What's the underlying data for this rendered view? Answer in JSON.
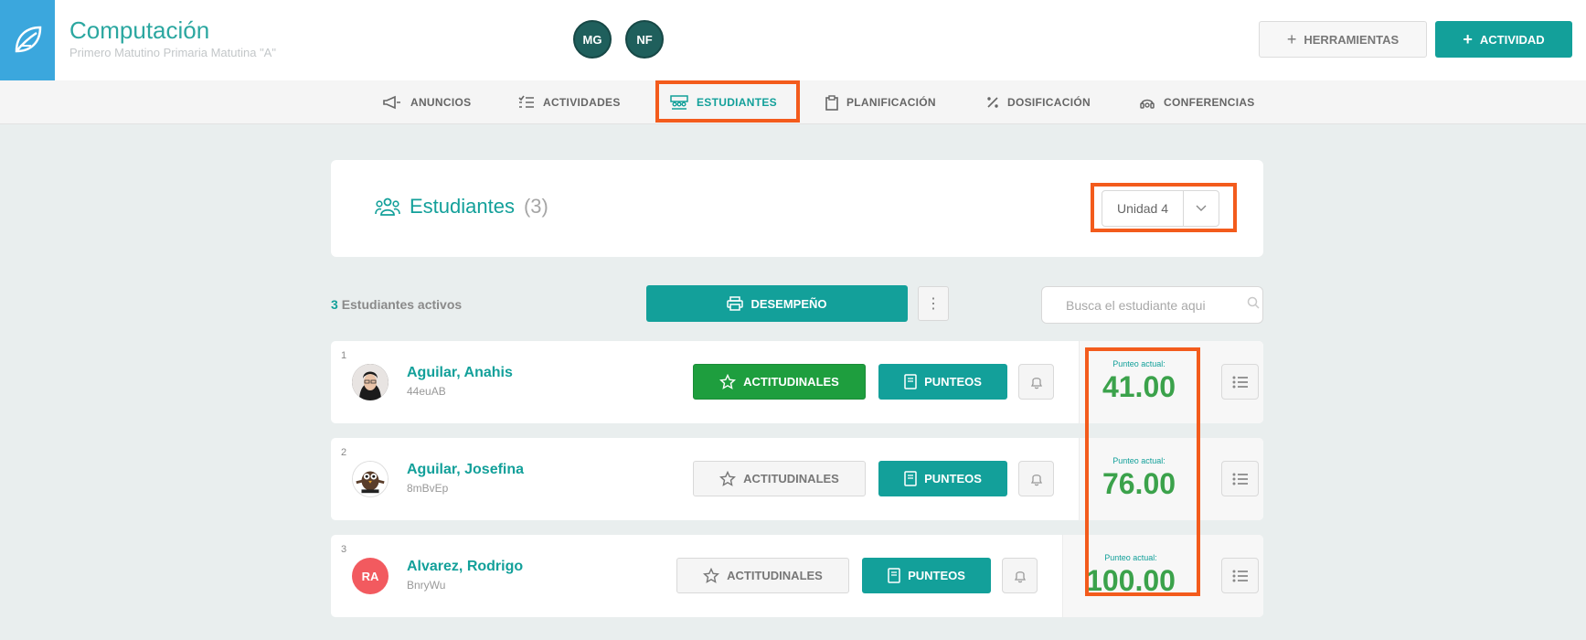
{
  "header": {
    "course_title": "Computación",
    "course_subtitle": "Primero Matutino Primaria Matutina \"A\"",
    "avatars": [
      "MG",
      "NF"
    ],
    "tools_label": "HERRAMIENTAS",
    "activity_label": "ACTIVIDAD"
  },
  "nav": {
    "items": [
      {
        "label": "ANUNCIOS",
        "icon": "megaphone-icon"
      },
      {
        "label": "ACTIVIDADES",
        "icon": "checklist-icon"
      },
      {
        "label": "ESTUDIANTES",
        "icon": "students-icon",
        "active": true
      },
      {
        "label": "PLANIFICACIÓN",
        "icon": "clipboard-icon"
      },
      {
        "label": "DOSIFICACIÓN",
        "icon": "percent-icon"
      },
      {
        "label": "CONFERENCIAS",
        "icon": "headset-icon"
      }
    ]
  },
  "students_panel": {
    "title": "Estudiantes",
    "count": "(3)",
    "unit_selected": "Unidad 4"
  },
  "toolbar": {
    "active_count_number": "3",
    "active_count_label": "Estudiantes activos",
    "desempeno_label": "DESEMPEÑO",
    "search_placeholder": "Busca el estudiante aqui"
  },
  "students": [
    {
      "num": "1",
      "name": "Aguilar, Anahis",
      "code": "44euAB",
      "actitudinales": "ACTITUDINALES",
      "actitudinales_active": true,
      "punteos": "PUNTEOS",
      "score_label": "Punteo actual:",
      "score": "41.00"
    },
    {
      "num": "2",
      "name": "Aguilar, Josefina",
      "code": "8mBvEp",
      "actitudinales": "ACTITUDINALES",
      "actitudinales_active": false,
      "punteos": "PUNTEOS",
      "score_label": "Punteo actual:",
      "score": "76.00"
    },
    {
      "num": "3",
      "name": "Alvarez, Rodrigo",
      "code": "BnryWu",
      "initials": "RA",
      "actitudinales": "ACTITUDINALES",
      "actitudinales_active": false,
      "punteos": "PUNTEOS",
      "score_label": "Punteo actual:",
      "score": "100.00"
    }
  ],
  "colors": {
    "accent": "#13a09a",
    "highlight": "#f35b1c",
    "score_green": "#3ba24b",
    "actitudinales_active": "#1e9e3e"
  }
}
